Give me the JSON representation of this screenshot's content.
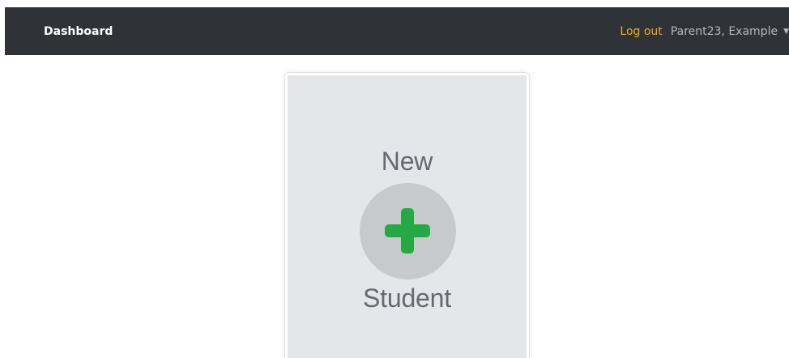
{
  "navbar": {
    "brand": "Dashboard",
    "logout_label": "Log out",
    "user_name": "Parent23, Example",
    "colors": {
      "background": "#2f3237",
      "logout": "#f0ad1c",
      "user": "#b6b8bb"
    }
  },
  "card": {
    "line_top": "New",
    "line_bottom": "Student",
    "icon": "plus-icon",
    "colors": {
      "background": "#e4e7ea",
      "text": "#656970",
      "circle": "#c8c9ca",
      "plus": "#28a745"
    }
  }
}
